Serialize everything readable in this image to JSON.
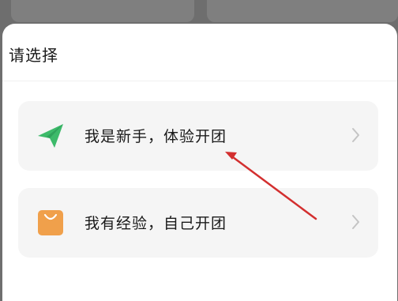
{
  "sheet": {
    "title": "请选择"
  },
  "options": [
    {
      "label": "我是新手，体验开团",
      "icon": "paper-plane-icon",
      "icon_color": "#3dba6a"
    },
    {
      "label": "我有经验，自己开团",
      "icon": "shopping-bag-icon",
      "icon_color": "#f0a04b"
    }
  ],
  "colors": {
    "annotation_arrow": "#d32f2f",
    "card_background": "#f5f5f5"
  }
}
